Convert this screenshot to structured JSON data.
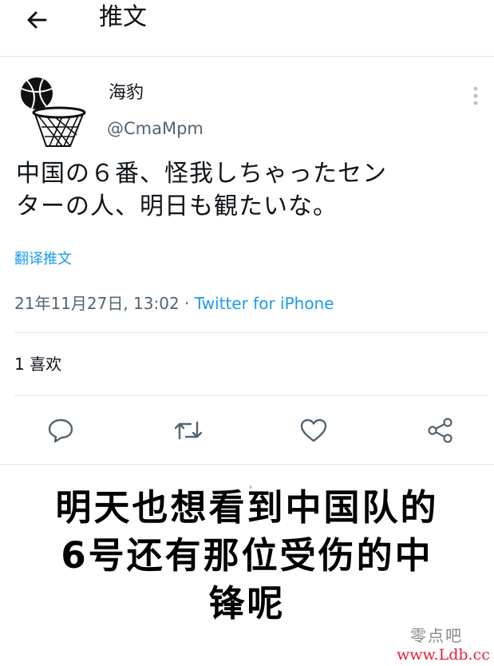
{
  "header": {
    "title": "推文",
    "back_icon": "arrow-left-icon"
  },
  "tweet": {
    "author": {
      "display_name": "海豹",
      "handle": "@CmaMpm",
      "avatar_icon": "basketball-hoop-icon"
    },
    "text_lines": [
      "中国の６番、怪我しちゃったセン",
      "ターの人、明日も観たいな。"
    ],
    "translate_label": "翻译推文",
    "timestamp": "21年11月27日, 13:02",
    "separator": " · ",
    "source": "Twitter for iPhone",
    "likes": "1 喜欢",
    "actions": {
      "reply_icon": "reply-icon",
      "retweet_icon": "retweet-icon",
      "like_icon": "heart-icon",
      "share_icon": "share-icon"
    },
    "link_color": "#1d9bf0"
  },
  "caption": {
    "lines": [
      "明天也想看到中国队的",
      "6号还有那位受伤的中",
      "锋呢"
    ]
  },
  "watermark": {
    "top": "零点吧",
    "bottom": "www.Ldb.cc"
  }
}
